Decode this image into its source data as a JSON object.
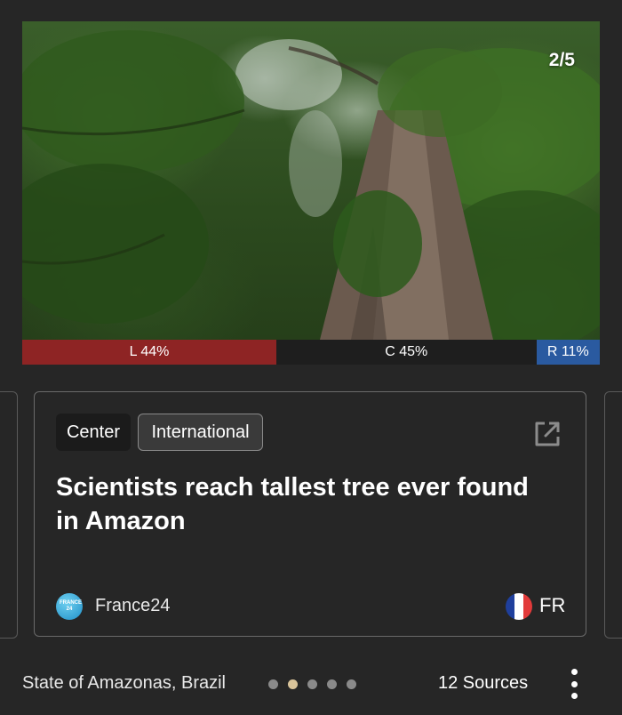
{
  "hero": {
    "counter": "2/5"
  },
  "bias": {
    "left_label": "L 44%",
    "center_label": "C 45%",
    "right_label": "R 11%",
    "left_pct": 44,
    "center_pct": 45,
    "right_pct": 11,
    "colors": {
      "left": "#8e2424",
      "center": "#1e1e1e",
      "right": "#2a5aa0"
    }
  },
  "card": {
    "tags": [
      "Center",
      "International"
    ],
    "headline": "Scientists reach tallest tree ever found in Amazon",
    "source_name": "France24",
    "source_logo_text": "FRANCE 24",
    "country": "FR",
    "icons": {
      "share": "external-link-icon",
      "flag": "france-flag-icon"
    }
  },
  "footer": {
    "location": "State of Amazonas, Brazil",
    "page_dots": {
      "count": 5,
      "active": 1
    },
    "sources": "12 Sources",
    "more_icon": "more-vertical-icon"
  }
}
